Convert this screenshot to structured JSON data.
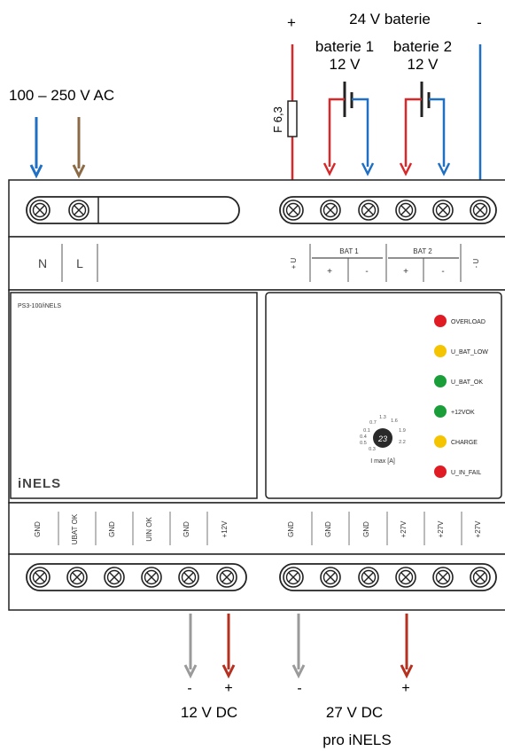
{
  "top_labels": {
    "plus": "+",
    "minus": "-",
    "battery_title": "24 V baterie",
    "battery1_name": "baterie 1",
    "battery1_voltage": "12 V",
    "battery2_name": "baterie 2",
    "battery2_voltage": "12 V",
    "ac_input": "100 – 250 V AC",
    "fuse": "F 6,3"
  },
  "upper_terminals": {
    "left": [
      "N",
      "L"
    ],
    "ubat_left": "+ U",
    "ubat_sub": "BAT",
    "bat1_label": "BAT 1",
    "bat1_signs": [
      "+",
      "-"
    ],
    "bat2_label": "BAT 2",
    "bat2_signs": [
      "+",
      "-"
    ],
    "ubat_right": "- U"
  },
  "panel": {
    "model": "PS3-100/iNELS",
    "logo": "iNELS",
    "dial_label": "I max [A]",
    "dial_center": "23",
    "dial_ticks": [
      "0.1",
      "0.4",
      "0.5",
      "0.7",
      "1.3",
      "1.6",
      "1.9",
      "2.2",
      "0.3"
    ]
  },
  "leds": [
    {
      "label": "OVERLOAD",
      "color": "#e01b24"
    },
    {
      "label": "U_BAT_LOW",
      "color": "#f5c400"
    },
    {
      "label": "U_BAT_OK",
      "color": "#1a9e3a"
    },
    {
      "label": "+12VOK",
      "color": "#1a9e3a"
    },
    {
      "label": "CHARGE",
      "color": "#f5c400"
    },
    {
      "label": "U_IN_FAIL",
      "color": "#e01b24"
    }
  ],
  "lower_terminals": {
    "left": [
      "GND",
      "UBAT OK",
      "GND",
      "UIN OK",
      "GND",
      "+12V"
    ],
    "right": [
      "GND",
      "GND",
      "GND",
      "+27V",
      "+27V",
      "+27V"
    ]
  },
  "bottom_labels": {
    "minus_12": "-",
    "plus_12": "+",
    "out_12": "12 V DC",
    "minus_27": "-",
    "plus_27": "+",
    "out_27": "27 V DC",
    "out_27_sub": "pro iNELS"
  },
  "colors": {
    "red": "#d8282a",
    "blue": "#1f6fc4",
    "brown": "#8b6a45",
    "gray": "#9a9a9a",
    "darkred": "#b5301f"
  }
}
